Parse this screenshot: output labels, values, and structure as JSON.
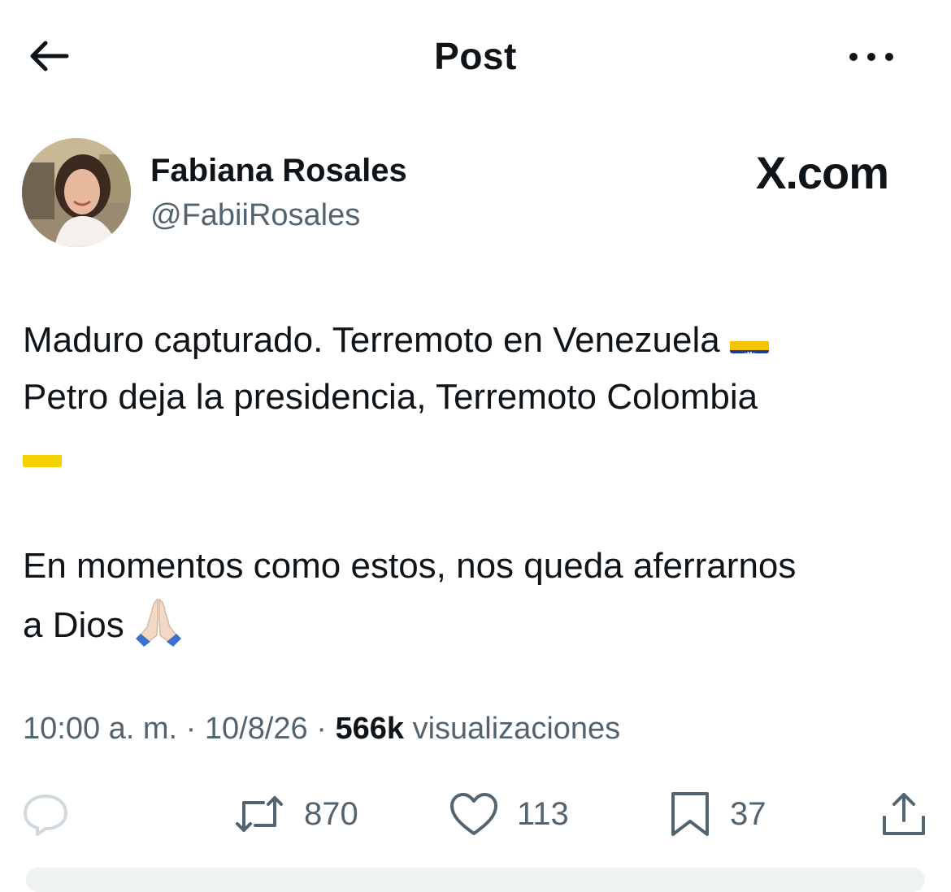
{
  "header": {
    "title": "Post"
  },
  "author": {
    "name": "Fabiana Rosales",
    "handle": "@FabiiRosales"
  },
  "brand": {
    "text": "X.com"
  },
  "post": {
    "line1": "Maduro capturado. Terremoto en Venezuela ",
    "line2": "Petro deja la presidencia, Terremoto Colombia",
    "line3": "En momentos como estos, nos queda aferrarnos",
    "line4": "a Dios"
  },
  "meta": {
    "time": "10:00 a. m.",
    "sep1": " · ",
    "date": "10/8/26",
    "sep2": " · ",
    "views": "566k",
    "views_label": " visualizaciones"
  },
  "actions": {
    "retweets": "870",
    "likes": "113",
    "bookmarks": "37"
  },
  "icons": {
    "back": "arrow-left-icon",
    "more": "more-horizontal-icon",
    "reply": "speech-bubble-icon",
    "retweet": "retweet-icon",
    "like": "heart-icon",
    "bookmark": "bookmark-icon",
    "share": "share-upload-icon",
    "pray": "folded-hands-emoji",
    "flag_ve": "venezuela-flag-emoji",
    "flag_co": "colombia-flag-emoji"
  },
  "colors": {
    "text": "#0f1419",
    "secondary": "#536471",
    "venezuela_yellow": "#f4c400",
    "venezuela_blue": "#1a3b9c",
    "venezuela_red": "#d52b1e"
  }
}
